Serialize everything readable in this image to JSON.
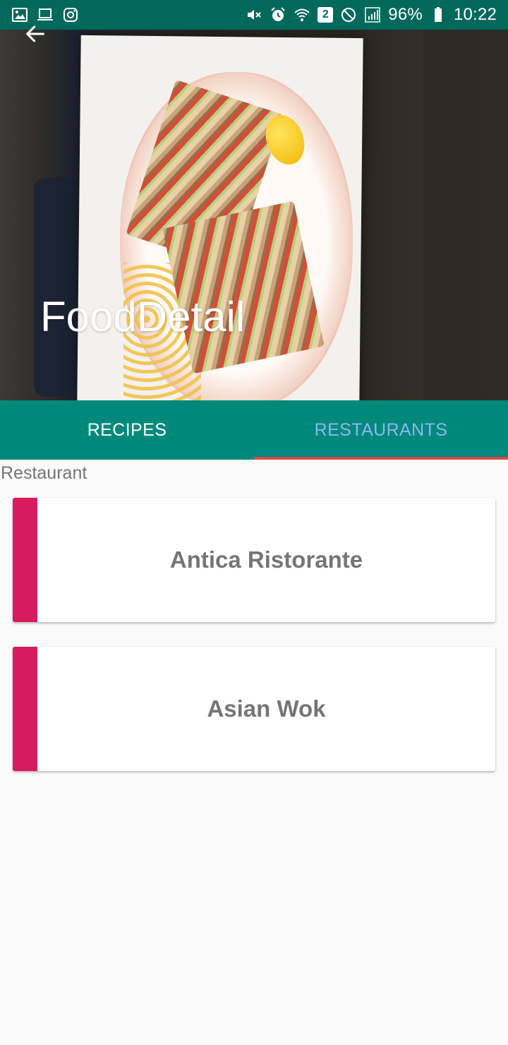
{
  "status_bar": {
    "battery": "96%",
    "time": "10:22",
    "sim_badge": "2",
    "left_icons": [
      "gallery-icon",
      "laptop-icon",
      "instagram-icon"
    ],
    "right_icons": [
      "mute-icon",
      "alarm-icon",
      "wifi-icon",
      "sim-icon",
      "block-icon",
      "signal-icon",
      "battery-icon"
    ]
  },
  "header": {
    "title": "FoodDetail",
    "back_icon": "arrow-left-icon"
  },
  "tabs": [
    {
      "label": "RECIPES",
      "selected": false
    },
    {
      "label": "RESTAURANTS",
      "selected": true
    }
  ],
  "colors": {
    "status_bar": "#00695c",
    "tab_bar": "#00897b",
    "tab_selected_text": "#8ab8f5",
    "tab_indicator": "#e04848",
    "card_accent": "#d81b60"
  },
  "section": {
    "label": "Restaurant"
  },
  "restaurants": [
    {
      "name": "Antica Ristorante"
    },
    {
      "name": "Asian Wok"
    }
  ]
}
